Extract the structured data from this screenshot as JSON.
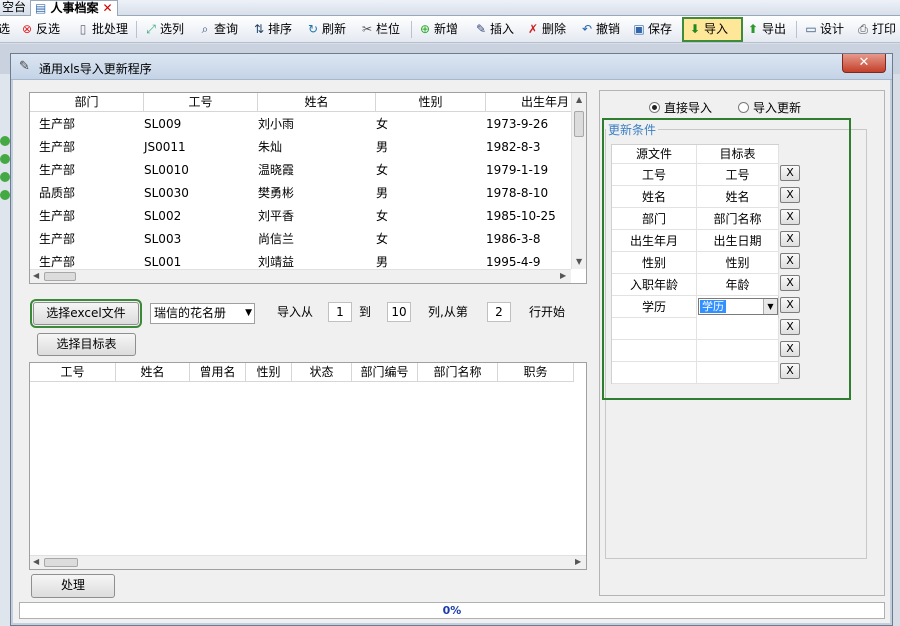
{
  "tabs": [
    {
      "label": "空台"
    },
    {
      "label": "人事档案",
      "active": true
    }
  ],
  "toolbar": [
    {
      "label": "选",
      "icon": "select-icon"
    },
    {
      "label": "反选",
      "icon": "invert-icon"
    },
    {
      "label": "批处理",
      "icon": "batch-icon"
    },
    {
      "label": "选列",
      "icon": "column-select-icon"
    },
    {
      "label": "查询",
      "icon": "search-icon"
    },
    {
      "label": "排序",
      "icon": "sort-icon"
    },
    {
      "label": "刷新",
      "icon": "refresh-icon"
    },
    {
      "label": "栏位",
      "icon": "fields-icon"
    },
    {
      "label": "新增",
      "icon": "add-icon"
    },
    {
      "label": "插入",
      "icon": "insert-icon"
    },
    {
      "label": "删除",
      "icon": "delete-icon"
    },
    {
      "label": "撤销",
      "icon": "undo-icon"
    },
    {
      "label": "保存",
      "icon": "save-icon"
    },
    {
      "label": "导入",
      "icon": "import-icon",
      "highlight": true
    },
    {
      "label": "导出",
      "icon": "export-icon"
    },
    {
      "label": "设计",
      "icon": "design-icon"
    },
    {
      "label": "打印",
      "icon": "print-icon"
    }
  ],
  "dialog": {
    "title": "通用xls导入更新程序",
    "close_label": "✕",
    "source_table": {
      "columns": [
        "部门",
        "工号",
        "姓名",
        "性别",
        "出生年月"
      ],
      "rows": [
        [
          "生产部",
          "SL009",
          "刘小雨",
          "女",
          "1973-9-26"
        ],
        [
          "生产部",
          "JS0011",
          "朱灿",
          "男",
          "1982-8-3"
        ],
        [
          "生产部",
          "SL0010",
          "温晓霞",
          "女",
          "1979-1-19"
        ],
        [
          "品质部",
          "SL0030",
          "樊勇彬",
          "男",
          "1978-8-10"
        ],
        [
          "生产部",
          "SL002",
          "刘平香",
          "女",
          "1985-10-25"
        ],
        [
          "生产部",
          "SL003",
          "尚信兰",
          "女",
          "1986-3-8"
        ],
        [
          "生产部",
          "SL001",
          "刘靖益",
          "男",
          "1995-4-9"
        ]
      ]
    },
    "select_excel_label": "选择excel文件",
    "sheet_combo": "瑞信的花名册",
    "import_from_label": "导入从",
    "from_value": "1",
    "to_label": "到",
    "to_value": "10",
    "col_from_label": "列,从第",
    "row_value": "2",
    "row_start_label": "行开始",
    "select_target_label": "选择目标表",
    "target_table": {
      "columns": [
        "工号",
        "姓名",
        "曾用名",
        "性别",
        "状态",
        "部门编号",
        "部门名称",
        "职务"
      ]
    },
    "process_label": "处理",
    "radio_direct": "直接导入",
    "radio_update": "导入更新",
    "update_conditions_label": "更新条件",
    "mapping": {
      "header_source": "源文件",
      "header_target": "目标表",
      "rows": [
        {
          "source": "工号",
          "target": "工号"
        },
        {
          "source": "姓名",
          "target": "姓名"
        },
        {
          "source": "部门",
          "target": "部门名称"
        },
        {
          "source": "出生年月",
          "target": "出生日期"
        },
        {
          "source": "性别",
          "target": "性别"
        },
        {
          "source": "入职年龄",
          "target": "年龄"
        },
        {
          "source": "学历",
          "target": "学历"
        },
        {
          "source": "",
          "target": ""
        },
        {
          "source": "",
          "target": ""
        },
        {
          "source": "",
          "target": ""
        }
      ],
      "x_label": "X"
    },
    "progress": {
      "value": 0,
      "text": "0%"
    }
  }
}
